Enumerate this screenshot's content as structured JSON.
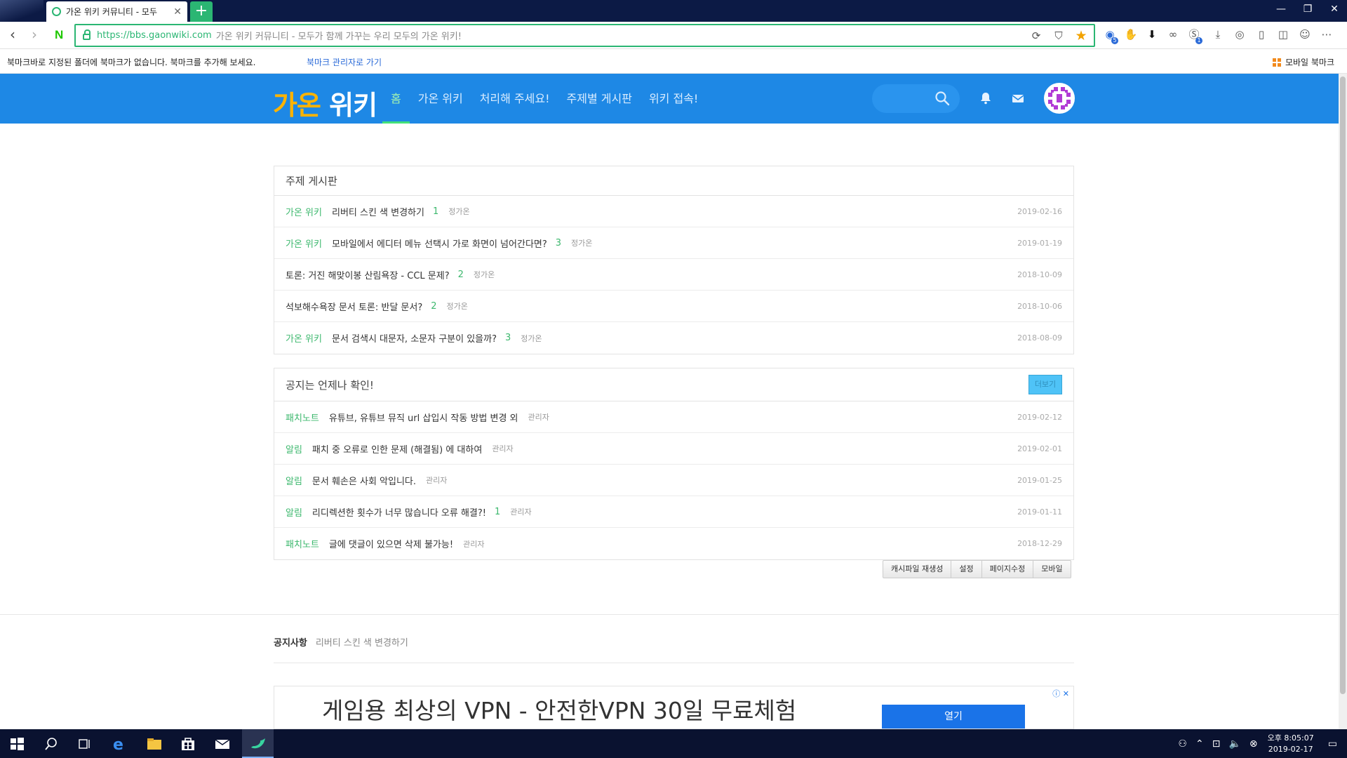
{
  "browser": {
    "tab_title": "가온 위키 커뮤니티 - 모두",
    "new_tab_label": "+",
    "url": "https://bbs.gaonwiki.com",
    "page_title": "가온 위키 커뮤니티 - 모두가 함께 가꾸는 우리 모두의 가온 위키!",
    "bookmark_message": "북마크바로 지정된 폴더에 북마크가 없습니다. 북마크를 추가해 보세요.",
    "bookmark_manager_link": "북마크 관리자로 가기",
    "mobile_bookmarks": "모바일 북마크",
    "ext_badge_1": "5",
    "ext_badge_2": "1"
  },
  "site": {
    "logo_part1": "가온",
    "logo_part2": "위키",
    "menu": [
      "홈",
      "가온 위키",
      "처리해 주세요!",
      "주제별 게시판",
      "위키 접속!"
    ]
  },
  "topic_board": {
    "title": "주제 게시판",
    "rows": [
      {
        "category": "가온 위키",
        "subject": "리버티 스킨 색 변경하기",
        "count": "1",
        "author": "정가온",
        "date": "2019-02-16"
      },
      {
        "category": "가온 위키",
        "subject": "모바일에서 에디터 메뉴 선택시 가로 화면이 넘어간다면?",
        "count": "3",
        "author": "정가온",
        "date": "2019-01-19"
      },
      {
        "category": "",
        "subject": "토론: 거진 해맞이봉 산림욕장 - CCL 문제?",
        "count": "2",
        "author": "정가온",
        "date": "2018-10-09"
      },
      {
        "category": "",
        "subject": "석보해수욕장 문서 토론: 반달 문서?",
        "count": "2",
        "author": "정가온",
        "date": "2018-10-06"
      },
      {
        "category": "가온 위키",
        "subject": "문서 검색시 대문자, 소문자 구분이 있을까?",
        "count": "3",
        "author": "정가온",
        "date": "2018-08-09"
      }
    ]
  },
  "notice_board": {
    "title": "공지는 언제나 확인!",
    "more_label": "더보기",
    "rows": [
      {
        "category": "패치노트",
        "subject": "유튜브, 유튜브 뮤직 url 삽입시 작동 방법 변경 외",
        "count": "",
        "author": "관리자",
        "date": "2019-02-12"
      },
      {
        "category": "알림",
        "subject": "패치 중 오류로 인한 문제 (해결됨) 에 대하여",
        "count": "",
        "author": "관리자",
        "date": "2019-02-01"
      },
      {
        "category": "알림",
        "subject": "문서 훼손은 사회 악입니다.",
        "count": "",
        "author": "관리자",
        "date": "2019-01-25"
      },
      {
        "category": "알림",
        "subject": "리디렉션한 횟수가 너무 많습니다 오류 해결?!",
        "count": "1",
        "author": "관리자",
        "date": "2019-01-11"
      },
      {
        "category": "패치노트",
        "subject": "글에 댓글이 있으면 삭제 불가능!",
        "count": "",
        "author": "관리자",
        "date": "2018-12-29"
      }
    ]
  },
  "admin_bar": [
    "캐시파일 재생성",
    "설정",
    "페이지수정",
    "모바일"
  ],
  "footer_notice": {
    "label": "공지사항",
    "text": "리버티 스킨 색 변경하기"
  },
  "ad": {
    "headline": "게임용 최상의 VPN - 안전한VPN 30일 무료체험",
    "button": "열기",
    "info": "ⓘ ✕"
  },
  "taskbar": {
    "clock_time": "오후 8:05:07",
    "clock_date": "2019-02-17"
  },
  "colors": {
    "header_blue": "#1e88e5",
    "accent_green": "#3db86e",
    "browser_green": "#2bb673",
    "logo_orange": "#ffb300"
  }
}
